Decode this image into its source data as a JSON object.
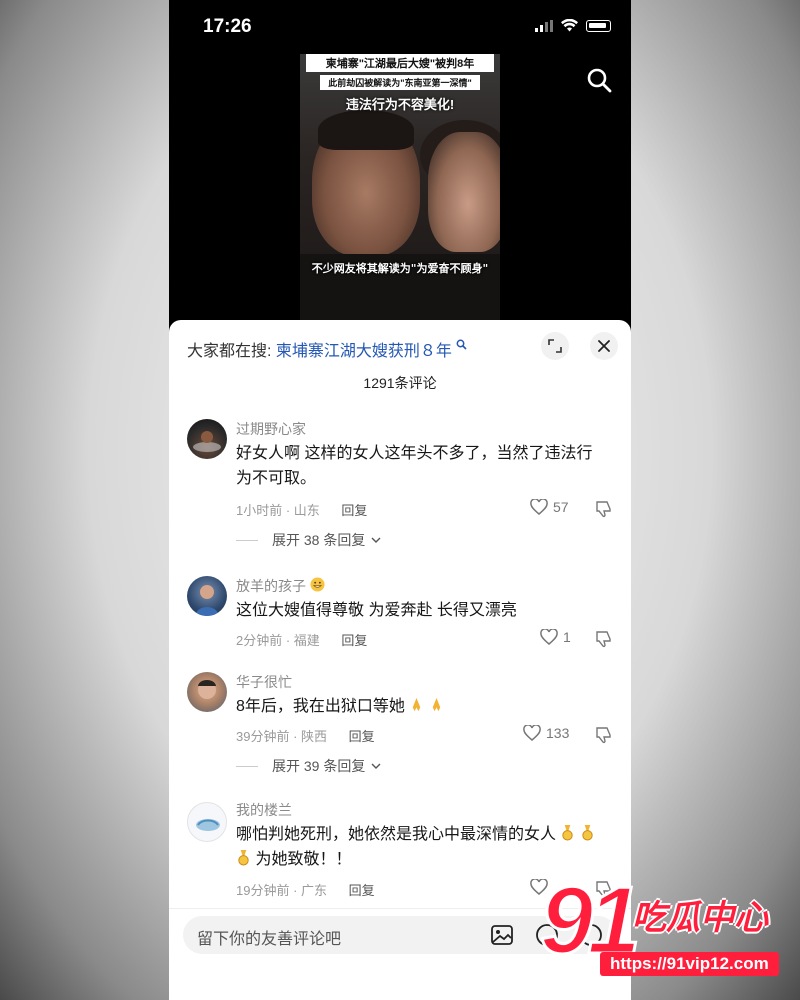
{
  "status_bar": {
    "time": "17:26"
  },
  "video": {
    "headline_line1": "柬埔寨\"江湖最后大嫂\"被判8年",
    "headline_line2": "此前劫囚被解读为\"东南亚第一深情\"",
    "headline_line3": "违法行为不容美化!",
    "caption": "不少网友将其解读为\"为爱奋不顾身\""
  },
  "sheet": {
    "hot_search_prefix": "大家都在搜:",
    "hot_search_query": "柬埔寨江湖大嫂获刑８年",
    "comment_count": "1291条评论"
  },
  "comments": [
    {
      "username": "过期野心家",
      "text": "好女人啊 这样的女人这年头不多了，当然了违法行为不可取。",
      "meta": "1小时前 · 山东",
      "reply_label": "回复",
      "likes": "57",
      "expand_label": "展开 38 条回复"
    },
    {
      "username": "放羊的孩子",
      "text": "这位大嫂值得尊敬 为爱奔赴 长得又漂亮",
      "meta": "2分钟前 · 福建",
      "reply_label": "回复",
      "likes": "1"
    },
    {
      "username": "华子很忙",
      "text": "8年后，我在出狱口等她",
      "meta": "39分钟前 · 陕西",
      "reply_label": "回复",
      "likes": "133",
      "expand_label": "展开 39 条回复"
    },
    {
      "username": "我的楼兰",
      "text": "哪怕判她死刑，她依然是我心中最深情的女人",
      "text_tail": "为她致敬！！",
      "meta": "19分钟前 · 广东",
      "reply_label": "回复"
    }
  ],
  "input": {
    "placeholder": "留下你的友善评论吧"
  },
  "watermark": {
    "number": "91",
    "title": "吃瓜中心",
    "url": "https://91vip12.com"
  },
  "colors": {
    "link": "#2458b3",
    "watermark_red": "#ff1f3d"
  }
}
